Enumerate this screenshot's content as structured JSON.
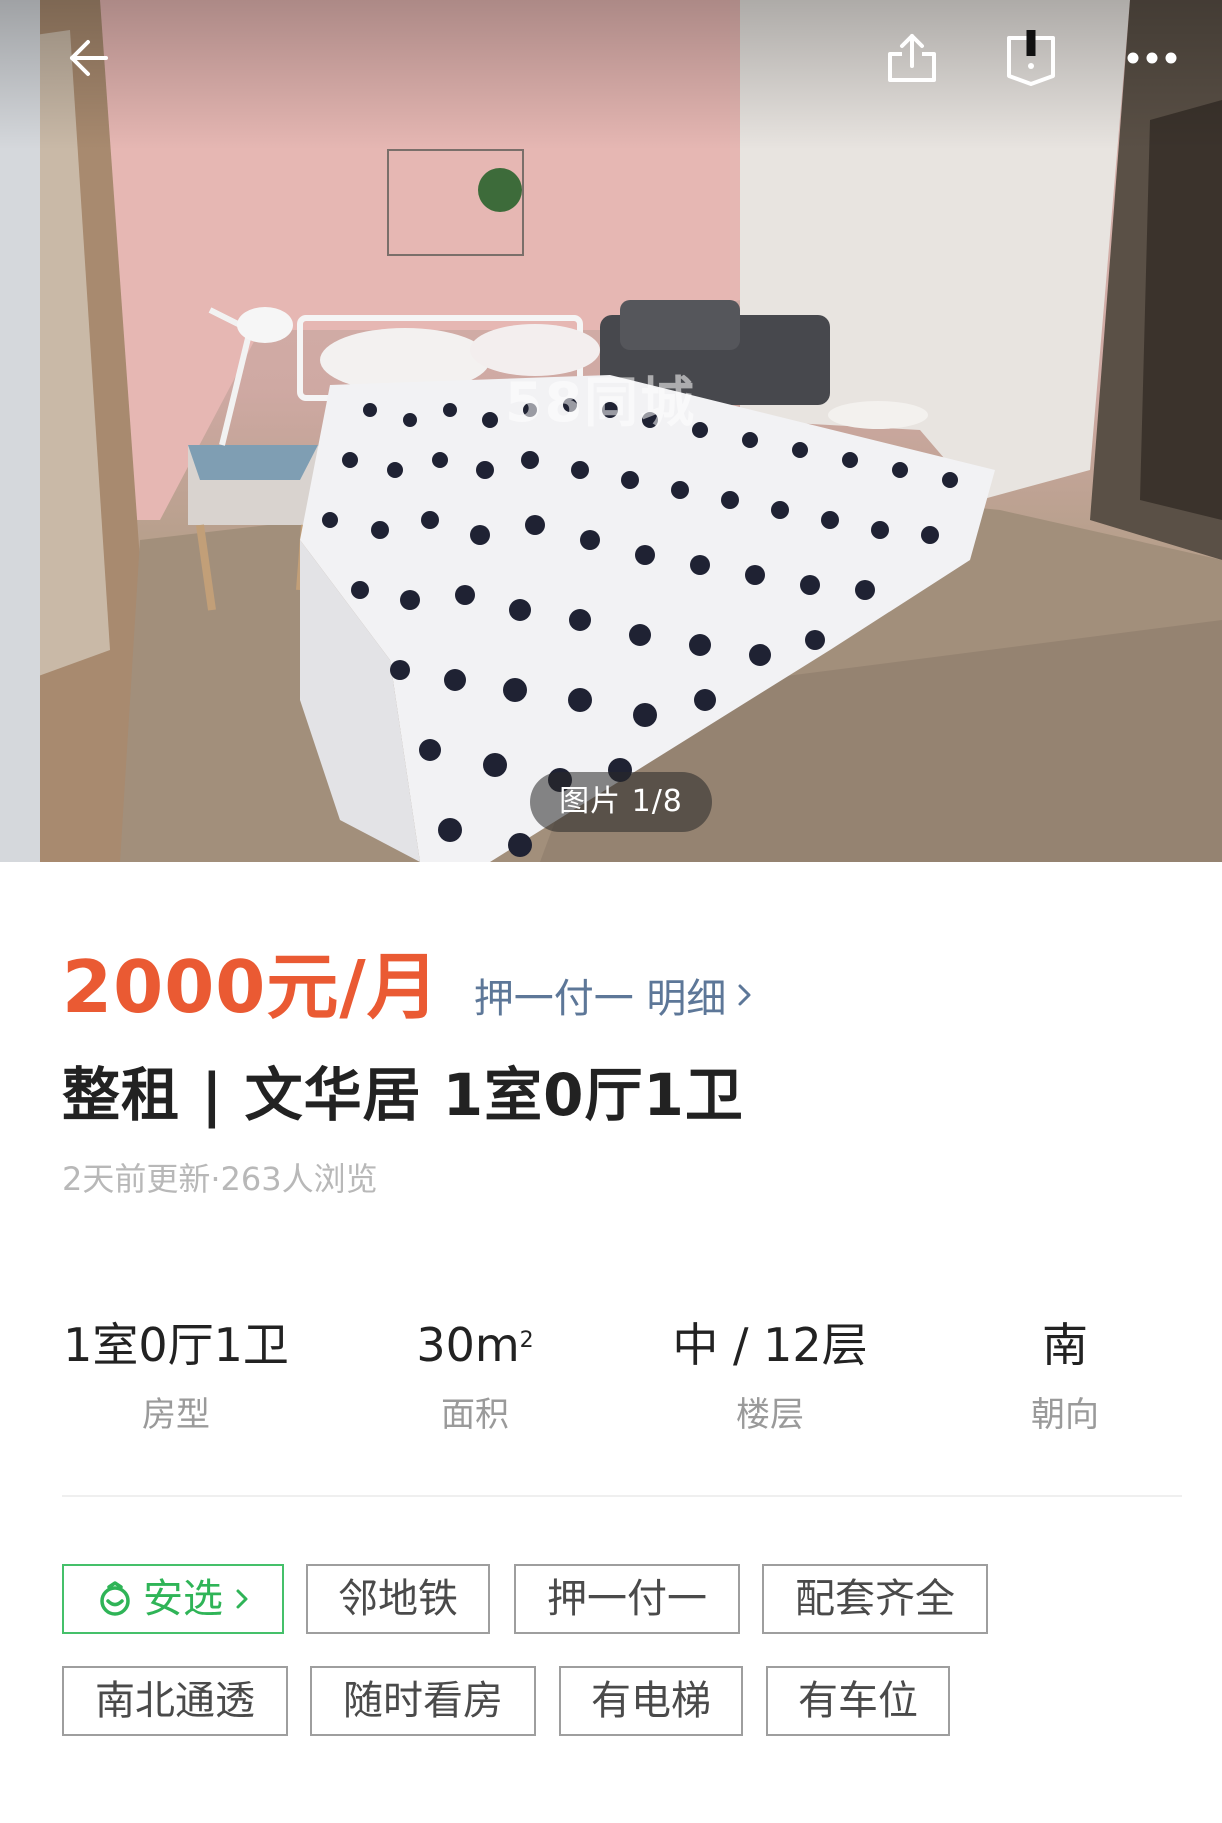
{
  "header": {
    "back_icon": "arrow-left-icon",
    "share_icon": "share-icon",
    "report_icon": "bookmark-icon",
    "more_icon": "more-dots-icon"
  },
  "gallery": {
    "counter": "图片 1/8",
    "watermark": "58同城"
  },
  "listing": {
    "price": "2000元/月",
    "deposit": "押一付一 明细",
    "title": "整租 | 文华居 1室0厅1卫",
    "meta": "2天前更新·263人浏览"
  },
  "specs": [
    {
      "value": "1室0厅1卫",
      "label": "房型"
    },
    {
      "value": "30m",
      "unit_sup": "2",
      "label": "面积"
    },
    {
      "value": "中 / 12层",
      "label": "楼层"
    },
    {
      "value": "南",
      "label": "朝向"
    }
  ],
  "tags": {
    "row1": [
      "安选",
      "邻地铁",
      "押一付一",
      "配套齐全"
    ],
    "row2": [
      "南北通透",
      "随时看房",
      "有电梯",
      "有车位"
    ]
  },
  "colors": {
    "price": "#ea5a33",
    "link": "#5d7798",
    "green": "#2fb457"
  }
}
